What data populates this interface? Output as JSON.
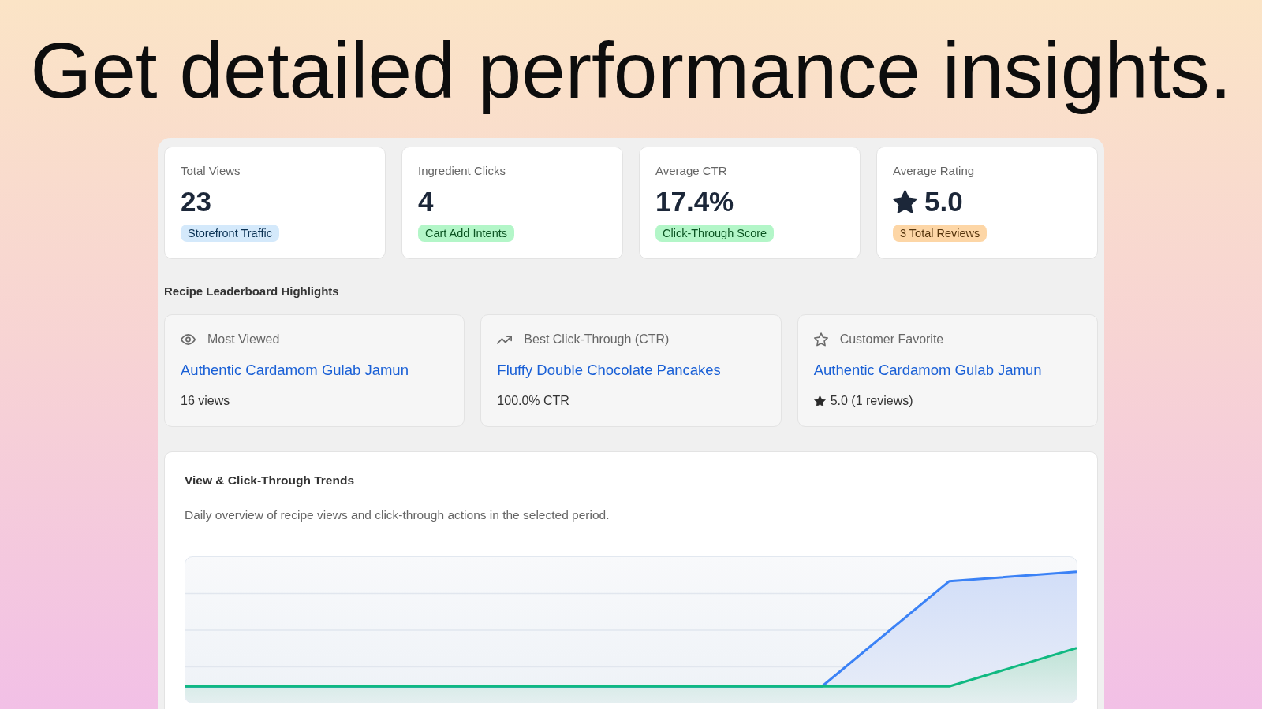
{
  "headline": "Get detailed performance insights.",
  "stats": [
    {
      "kind": "count",
      "label": "Total Views",
      "value": "23",
      "badge": {
        "text": "Storefront Traffic",
        "color": "#d4e9fb"
      }
    },
    {
      "kind": "count",
      "label": "Ingredient Clicks",
      "value": "4",
      "badge": {
        "text": "Cart Add Intents",
        "color": "#b3f6c8"
      }
    },
    {
      "kind": "count",
      "label": "Average CTR",
      "value": "17.4%",
      "badge": {
        "text": "Click-Through Score",
        "color": "#b3f6c8"
      }
    },
    {
      "kind": "rating",
      "label": "Average Rating",
      "value": "5.0",
      "badge": {
        "text": "3 Total Reviews",
        "color": "#fdd6a6"
      }
    }
  ],
  "leaderboard": {
    "title": "Recipe Leaderboard Highlights",
    "items": [
      {
        "kind": "views",
        "label": "Most Viewed",
        "recipe": "Authentic Cardamom Gulab Jamun",
        "detail": "16 views"
      },
      {
        "kind": "ctr",
        "label": "Best Click-Through (CTR)",
        "recipe": "Fluffy Double Chocolate Pancakes",
        "detail": "100.0% CTR"
      },
      {
        "kind": "rating",
        "label": "Customer Favorite",
        "recipe": "Authentic Cardamom Gulab Jamun",
        "detail": "5.0 (1 reviews)"
      }
    ]
  },
  "trends": {
    "title": "View & Click-Through Trends",
    "description": "Daily overview of recipe views and click-through actions in the selected period."
  }
}
